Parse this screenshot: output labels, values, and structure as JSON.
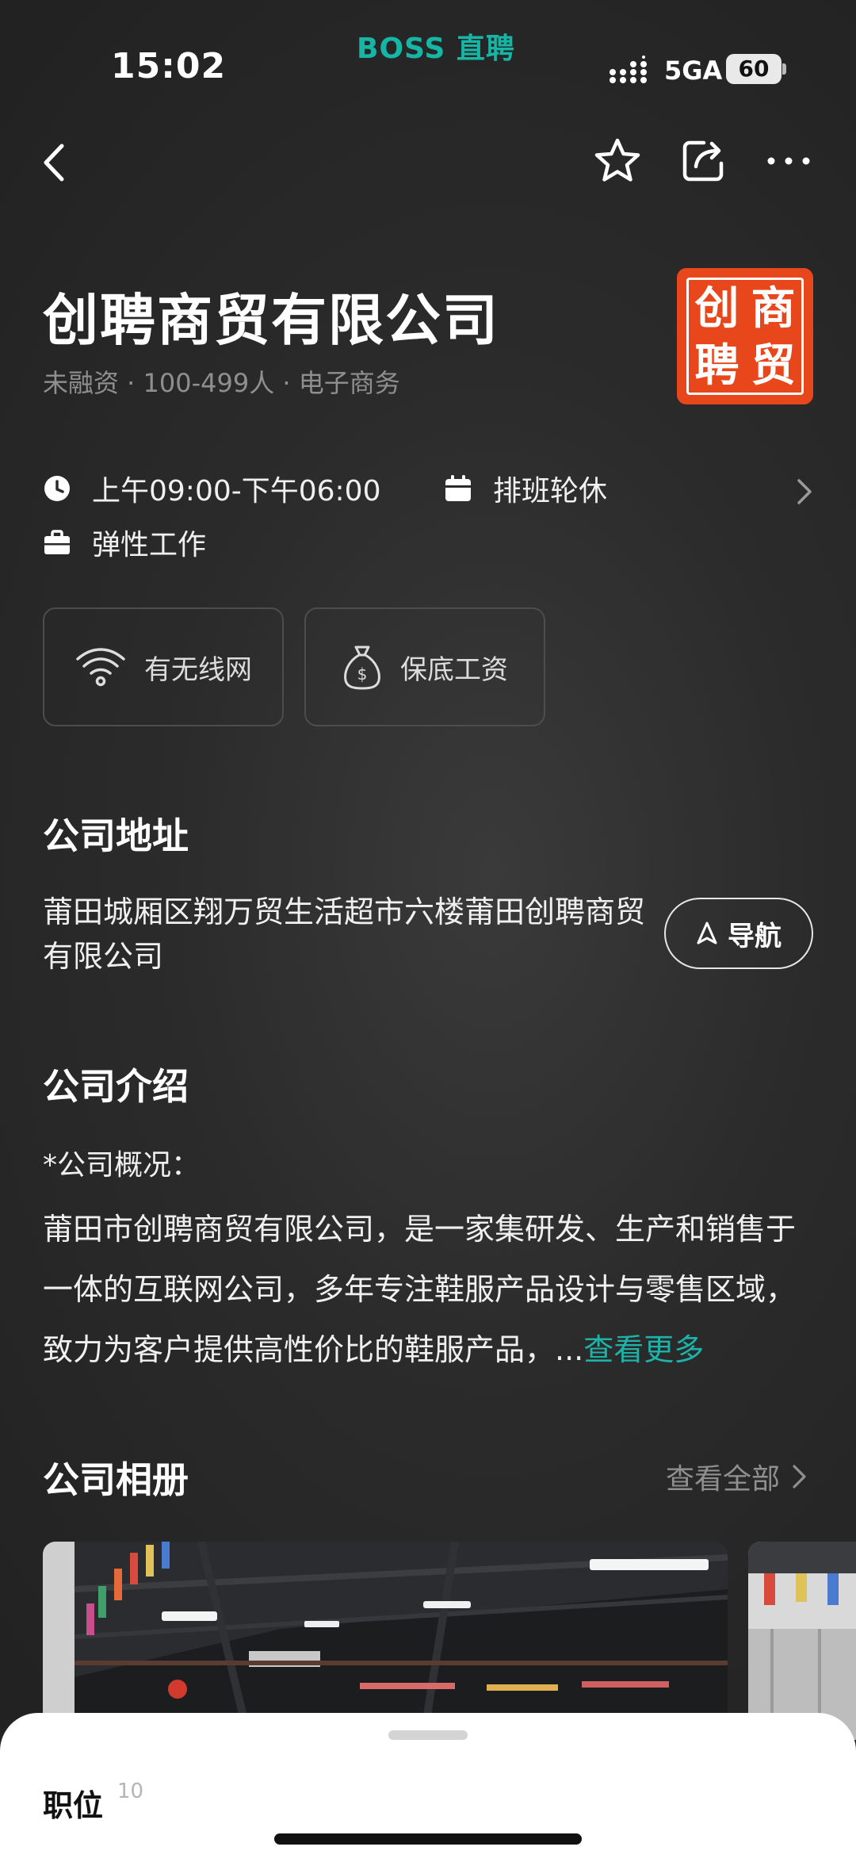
{
  "status_bar": {
    "time": "15:02",
    "app_brand": "BOSS 直聘",
    "network": "5GA",
    "battery": "60"
  },
  "nav": {
    "back_icon": "chevron-left-icon",
    "favorite_icon": "star-icon",
    "share_icon": "share-icon",
    "more_icon": "more-icon"
  },
  "company": {
    "name": "创聘商贸有限公司",
    "meta": "未融资 · 100-499人 · 电子商务",
    "logo_chars": [
      "创",
      "商",
      "聘",
      "贸"
    ],
    "logo_color": "#e8461b"
  },
  "work_info": {
    "hours": "上午09:00-下午06:00",
    "shift": "排班轮休",
    "flexibility": "弹性工作"
  },
  "benefits": [
    {
      "label": "有无线网",
      "icon": "wifi-icon"
    },
    {
      "label": "保底工资",
      "icon": "money-bag-icon"
    }
  ],
  "address": {
    "title": "公司地址",
    "text": "莆田城厢区翔万贸生活超市六楼莆田创聘商贸有限公司",
    "nav_button": "导航"
  },
  "intro": {
    "title": "公司介绍",
    "heading": "*公司概况：",
    "body": "莆田市创聘商贸有限公司，是一家集研发、生产和销售于一体的互联网公司，多年专注鞋服产品设计与零售区域，致力为客户提供高性价比的鞋服产品，...",
    "more_link": "查看更多"
  },
  "album": {
    "title": "公司相册",
    "view_all": "查看全部"
  },
  "jobs_sheet": {
    "title": "职位",
    "count": "10"
  },
  "colors": {
    "accent": "#1cb3a8",
    "brand": "#16b6a6",
    "background": "#2b2b2b"
  }
}
